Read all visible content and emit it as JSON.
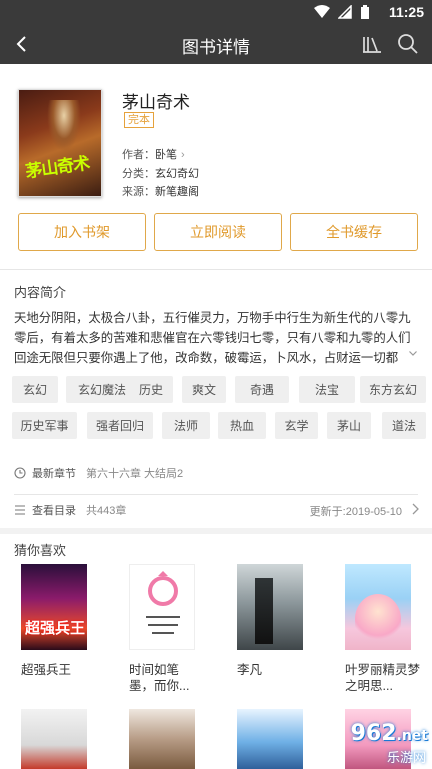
{
  "status_bar": {
    "time": "11:25"
  },
  "app_bar": {
    "title": "图书详情"
  },
  "book": {
    "title": "茅山奇术",
    "status_badge": "完本",
    "cover_text": "茅山奇术",
    "author_label": "作者：",
    "author": "卧笔",
    "category_label": "分类：",
    "category": "玄幻奇幻",
    "source_label": "来源：",
    "source": "新笔趣阁"
  },
  "actions": {
    "add_shelf": "加入书架",
    "read_now": "立即阅读",
    "cache_all": "全书缓存"
  },
  "intro": {
    "title": "内容简介",
    "text": "天地分阴阳，太极合八卦，五行催灵力，万物手中行生为新生代的八零九零后，有着太多的苦难和悲催官在六零钱归七零，只有八零和九零的人们回途无限但只要你遇上了他，改命数，破霉运，卜风水，占财运一切都"
  },
  "tags": [
    "玄幻",
    "玄幻魔法",
    "历史",
    "爽文",
    "奇遇",
    "法宝",
    "东方玄幻",
    "历史军事",
    "强者回归",
    "法师",
    "热血",
    "玄学",
    "茅山",
    "道法"
  ],
  "latest": {
    "label": "最新章节",
    "value": "第六十六章 大结局2"
  },
  "catalog": {
    "label": "查看目录",
    "count": "共443章",
    "updated": "更新于:2019-05-10"
  },
  "recommend": {
    "title": "猜你喜欢",
    "items": [
      {
        "name": "超强兵王"
      },
      {
        "name": "时间如笔墨，而你..."
      },
      {
        "name": "李凡"
      },
      {
        "name": "叶罗丽精灵梦之明思..."
      }
    ]
  },
  "watermark": {
    "text1": "962",
    "text2": ".net",
    "text3": "乐游网"
  },
  "colors": {
    "accent": "#e09a2c",
    "bar": "#3a3a3a"
  }
}
